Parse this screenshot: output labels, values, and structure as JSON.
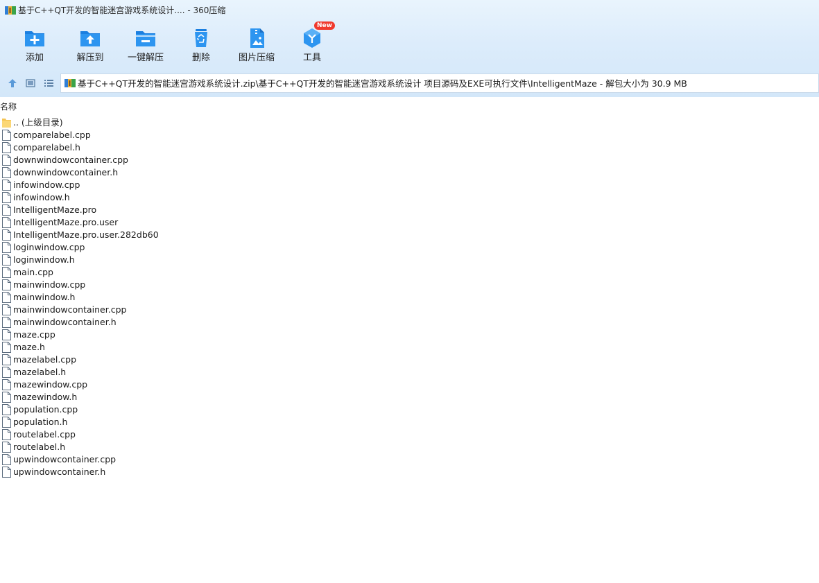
{
  "window": {
    "title": "基于C++QT开发的智能迷宫游戏系统设计.... - 360压缩",
    "app_icon": "archive-icon"
  },
  "toolbar": {
    "items": [
      {
        "label": "添加",
        "icon": "add-folder-icon"
      },
      {
        "label": "解压到",
        "icon": "extract-to-icon"
      },
      {
        "label": "一键解压",
        "icon": "one-click-extract-icon"
      },
      {
        "label": "删除",
        "icon": "recycle-icon"
      },
      {
        "label": "图片压缩",
        "icon": "image-compress-icon"
      },
      {
        "label": "工具",
        "icon": "tools-icon"
      }
    ],
    "new_badge": "New",
    "accent": "#1e88e5"
  },
  "nav": {
    "path": "基于C++QT开发的智能迷宫游戏系统设计.zip\\基于C++QT开发的智能迷宫游戏系统设计 项目源码及EXE可执行文件\\IntelligentMaze - 解包大小为 30.9 MB"
  },
  "list": {
    "column_name": "名称",
    "parent_label": ".. (上级目录)",
    "files": [
      "comparelabel.cpp",
      "comparelabel.h",
      "downwindowcontainer.cpp",
      "downwindowcontainer.h",
      "infowindow.cpp",
      "infowindow.h",
      "IntelligentMaze.pro",
      "IntelligentMaze.pro.user",
      "IntelligentMaze.pro.user.282db60",
      "loginwindow.cpp",
      "loginwindow.h",
      "main.cpp",
      "mainwindow.cpp",
      "mainwindow.h",
      "mainwindowcontainer.cpp",
      "mainwindowcontainer.h",
      "maze.cpp",
      "maze.h",
      "mazelabel.cpp",
      "mazelabel.h",
      "mazewindow.cpp",
      "mazewindow.h",
      "population.cpp",
      "population.h",
      "routelabel.cpp",
      "routelabel.h",
      "upwindowcontainer.cpp",
      "upwindowcontainer.h"
    ]
  }
}
